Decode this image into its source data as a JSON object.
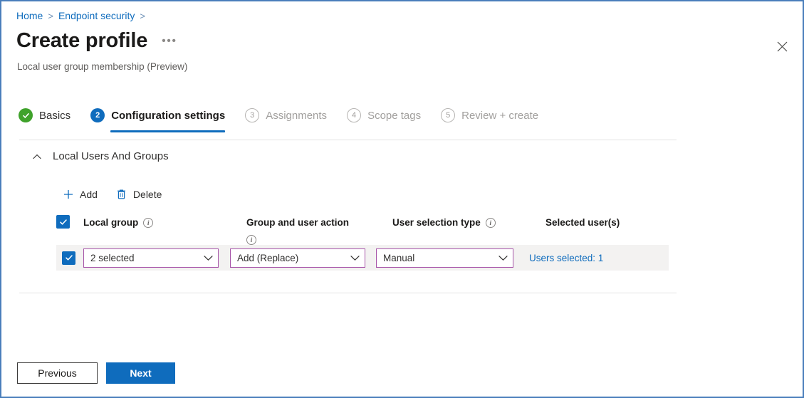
{
  "breadcrumb": {
    "items": [
      "Home",
      "Endpoint security"
    ],
    "separator": ">"
  },
  "header": {
    "title": "Create profile",
    "more_label": "•••",
    "subtitle": "Local user group membership (Preview)",
    "close_label": "Close"
  },
  "wizard": {
    "tabs": [
      {
        "marker": "✓",
        "label": "Basics",
        "state": "done"
      },
      {
        "marker": "2",
        "label": "Configuration settings",
        "state": "active"
      },
      {
        "marker": "3",
        "label": "Assignments",
        "state": "disabled"
      },
      {
        "marker": "4",
        "label": "Scope tags",
        "state": "disabled"
      },
      {
        "marker": "5",
        "label": "Review + create",
        "state": "disabled"
      }
    ]
  },
  "section": {
    "title": "Local Users And Groups",
    "expanded": true
  },
  "commands": [
    {
      "icon": "plus-icon",
      "glyph": "+",
      "label": "Add"
    },
    {
      "icon": "trash-icon",
      "glyph": "",
      "label": "Delete"
    }
  ],
  "table": {
    "columns": [
      {
        "key": "select",
        "label": "",
        "info": false
      },
      {
        "key": "local_group",
        "label": "Local group",
        "info": true
      },
      {
        "key": "group_user_action",
        "label": "Group and user action",
        "info": true
      },
      {
        "key": "user_selection_type",
        "label": "User selection type",
        "info": true
      },
      {
        "key": "selected_users",
        "label": "Selected user(s)",
        "info": false
      }
    ],
    "info_glyph": "i",
    "rows": [
      {
        "checked": true,
        "local_group": "2 selected",
        "group_user_action": "Add (Replace)",
        "user_selection_type": "Manual",
        "selected_users_link": "Users selected: 1"
      }
    ]
  },
  "footer": {
    "previous_label": "Previous",
    "next_label": "Next"
  },
  "colors": {
    "accent_blue": "#0f6cbd",
    "success_green": "#3fa22b",
    "dropdown_border": "#a653a8",
    "row_background": "#f3f2f1",
    "window_border": "#4a7ebb"
  }
}
